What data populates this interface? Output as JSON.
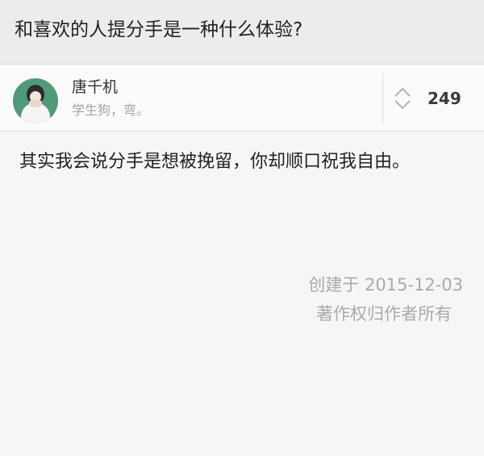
{
  "question": {
    "title": "和喜欢的人提分手是一种什么体验?"
  },
  "author": {
    "name": "唐千机",
    "bio": "学生狗，弯。",
    "avatar": "avatar-photo"
  },
  "vote": {
    "count": "249",
    "icon": "vote-arrows-icon"
  },
  "answer": {
    "text": "其实我会说分手是想被挽留，你却顺口祝我自由。"
  },
  "meta": {
    "created": "创建于 2015-12-03",
    "copyright": "著作权归作者所有"
  },
  "colors": {
    "background": "#f6f6f8",
    "header": "#ececee",
    "muted_text": "#aaaaae",
    "avatar_bg": "#4f9a78"
  }
}
